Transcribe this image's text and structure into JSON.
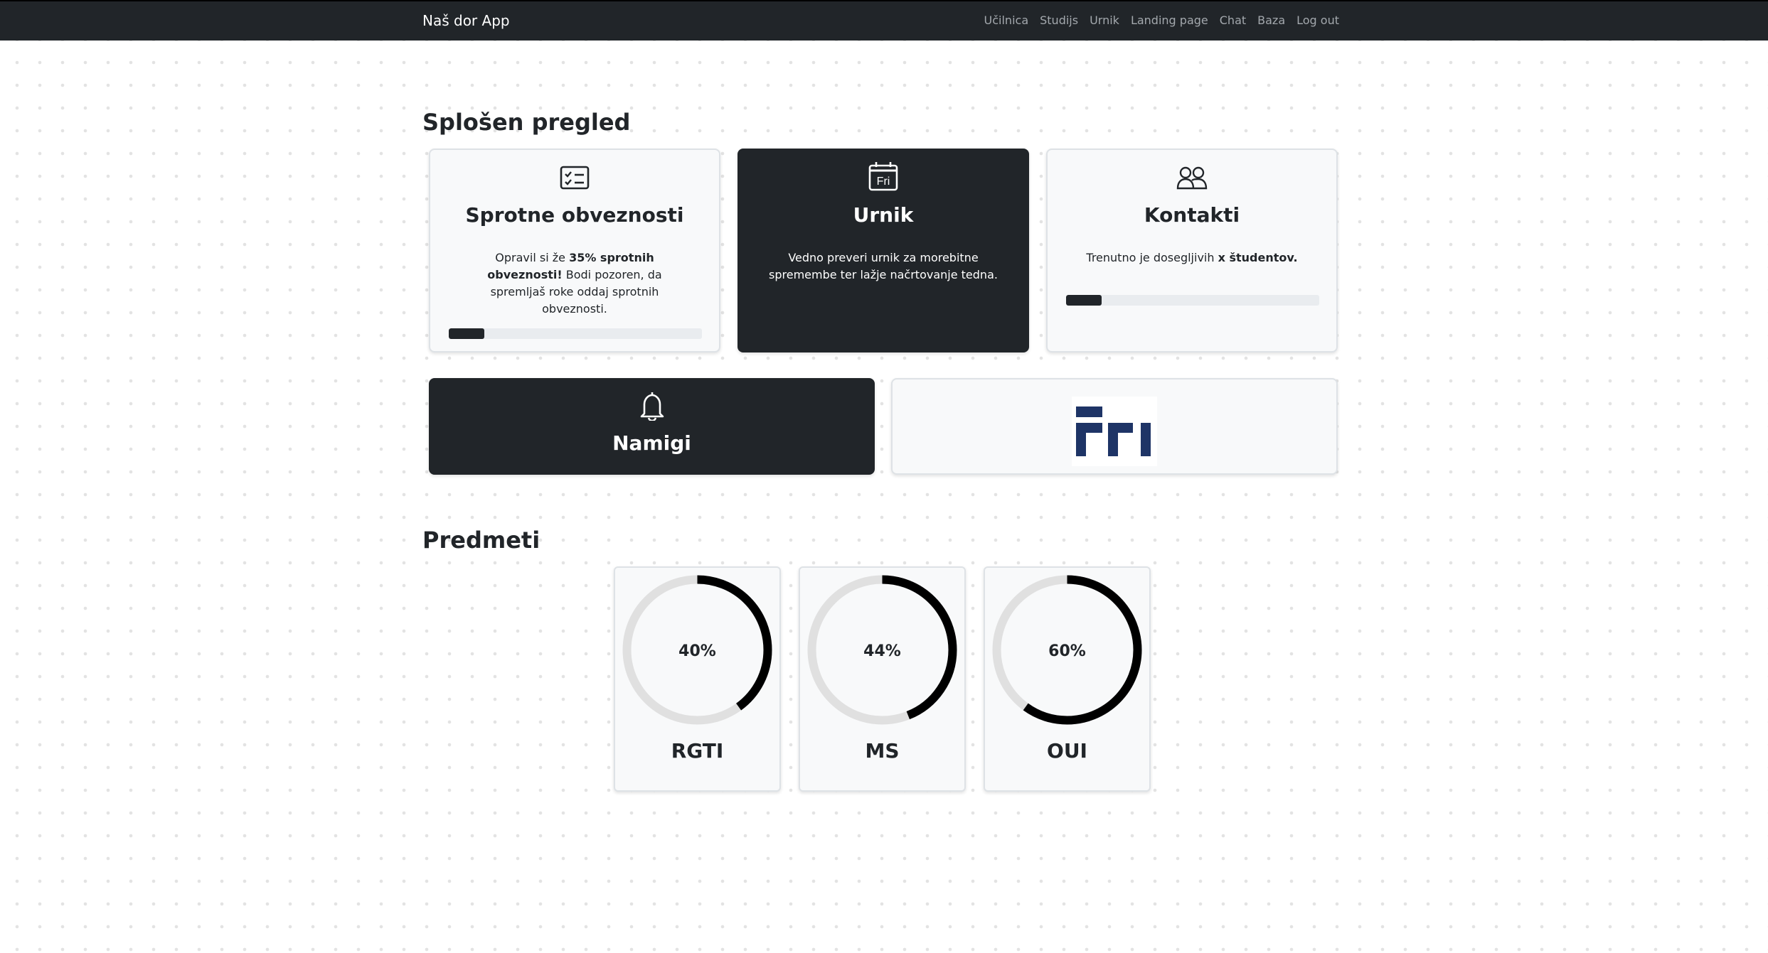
{
  "navbar": {
    "brand": "Naš dor App",
    "links": [
      "Učilnica",
      "Studijs",
      "Urnik",
      "Landing page",
      "Chat",
      "Baza",
      "Log out"
    ]
  },
  "overview": {
    "title": "Splošen pregled",
    "obligations": {
      "icon": "checklist-icon",
      "title": "Sprotne obveznosti",
      "text_prefix": "Opravil si že ",
      "text_bold": "35% sprotnih obveznosti!",
      "text_suffix": " Bodi pozoren, da spremljaš roke oddaj sprotnih obveznosti.",
      "progress": 0.14
    },
    "schedule": {
      "icon": "calendar-icon",
      "icon_text": "Fri",
      "title": "Urnik",
      "text": "Vedno preveri urnik za morebitne spremembe ter lažje načrtovanje tedna."
    },
    "contacts": {
      "icon": "people-icon",
      "title": "Kontakti",
      "text_prefix": "Trenutno je dosegljivih ",
      "text_bold": "x študentov.",
      "progress": 0.14
    },
    "tips": {
      "icon": "bell-icon",
      "title": "Namigi"
    },
    "logo": {
      "alt": "FRI"
    }
  },
  "subjects": {
    "title": "Predmeti",
    "items": [
      {
        "name": "RGTI",
        "percent_label": "40%",
        "value": 40
      },
      {
        "name": "MS",
        "percent_label": "44%",
        "value": 44
      },
      {
        "name": "OUI",
        "percent_label": "60%",
        "value": 60
      }
    ]
  },
  "colors": {
    "dark": "#212529",
    "ring_track": "#e0e0e0",
    "ring_fill": "#000000",
    "logo_blue": "#1e3466"
  }
}
